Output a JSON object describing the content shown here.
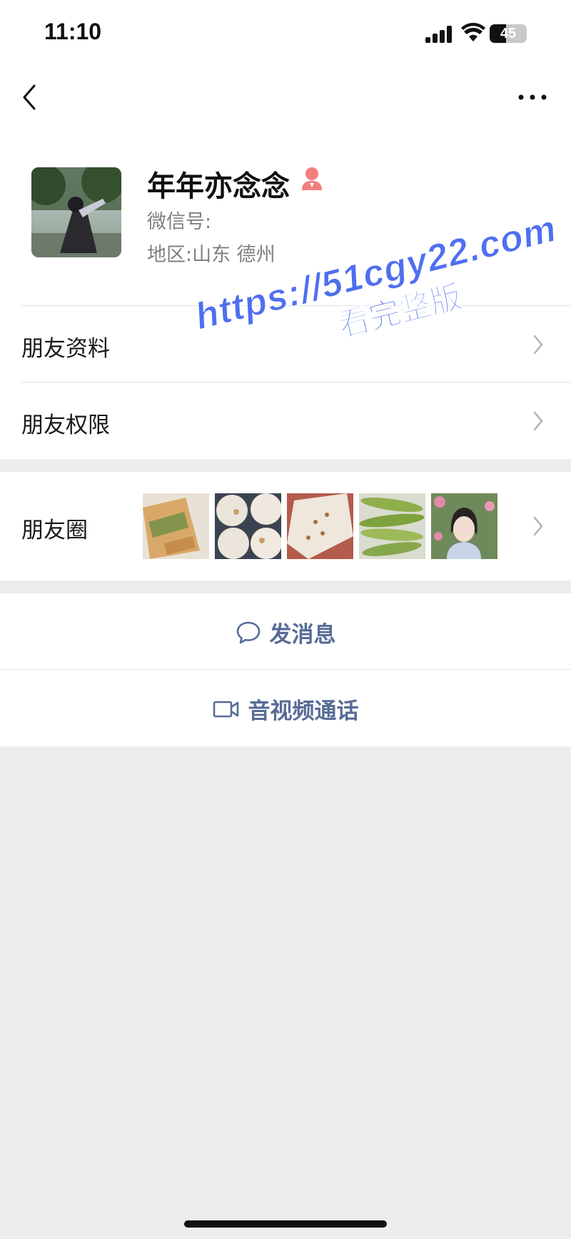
{
  "status_bar": {
    "time": "11:10",
    "battery": "45",
    "battery_level": 0.45,
    "icons": [
      "signal-icon",
      "wifi-icon",
      "battery-icon"
    ]
  },
  "nav": {
    "back_icon": "chevron-left-icon",
    "more_icon": "more-dots-icon"
  },
  "profile": {
    "nickname": "年年亦念念",
    "wechat_id_label": "微信号:",
    "region": "地区:山东 德州",
    "gender_icon": "female-icon"
  },
  "menu": {
    "friend_info": "朋友资料",
    "friend_permissions": "朋友权限",
    "moments": "朋友圈"
  },
  "actions": {
    "send_message": "发消息",
    "video_call": "音视频通话"
  },
  "watermark": {
    "line1": "https://51cgy22.com",
    "line2": "看完整版"
  },
  "colors": {
    "link_blue": "#576b95",
    "background": "#ededed",
    "watermark": "#4f6ff0",
    "gender": "#f37e7d"
  }
}
